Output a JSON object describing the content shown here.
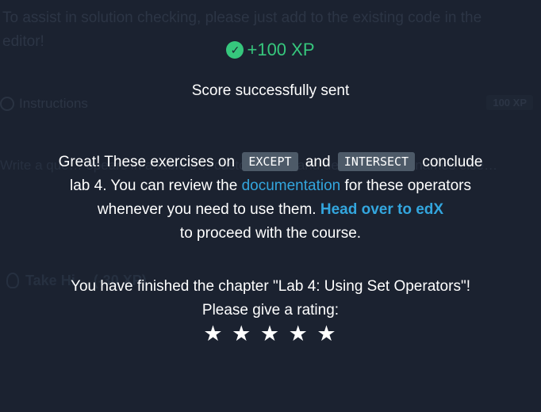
{
  "background": {
    "context_text": "To assist in solution checking, please just add to the existing code in the editor!",
    "instructions_label": "Instructions",
    "instructions_xp": "100 XP",
    "task_text": "Write a que… opears in a table o… custome… d, and default column names else…",
    "hint_label": "Take Hi… (-30 XP)"
  },
  "result": {
    "xp_check_icon": "check-circle-icon",
    "xp_text": "+100 XP",
    "score_status": "Score successfully sent"
  },
  "message": {
    "part1": "Great! These exercises on",
    "code1": "EXCEPT",
    "part2": "and",
    "code2": "INTERSECT",
    "part3": "conclude lab 4. You can review the",
    "link1": "documentation",
    "part4": "for these operators whenever you need to use them.",
    "link2": "Head over to edX",
    "part5": "to proceed with the course."
  },
  "chapter": {
    "finished_text": "You have finished the chapter \"Lab 4: Using Set Operators\"!",
    "rating_prompt": "Please give a rating:",
    "stars": [
      "★",
      "★",
      "★",
      "★",
      "★"
    ]
  },
  "colors": {
    "background": "#1b2230",
    "success_green": "#36c77d",
    "link_blue": "#33a6de",
    "code_chip": "#4d5a68"
  }
}
